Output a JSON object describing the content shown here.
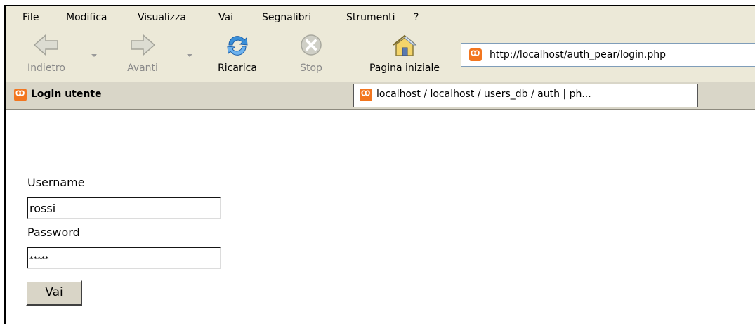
{
  "menubar": {
    "items": [
      {
        "label": "File"
      },
      {
        "label": "Modifica"
      },
      {
        "label": "Visualizza"
      },
      {
        "label": "Vai"
      },
      {
        "label": "Segnalibri"
      },
      {
        "label": "Strumenti"
      },
      {
        "label": "?"
      }
    ]
  },
  "toolbar": {
    "back_label": "Indietro",
    "forward_label": "Avanti",
    "reload_label": "Ricarica",
    "stop_label": "Stop",
    "home_label": "Pagina iniziale",
    "url": "http://localhost/auth_pear/login.php"
  },
  "tabs": [
    {
      "label": "Login utente",
      "active": true
    },
    {
      "label": "localhost / localhost / users_db  / auth | ph...",
      "active": false
    }
  ],
  "form": {
    "username_label": "Username",
    "username_value": "rossi",
    "password_label": "Password",
    "password_value": "*****",
    "submit_label": "Vai"
  },
  "colors": {
    "chrome_bg": "#ece9d8",
    "favicon": "#f2761f"
  }
}
